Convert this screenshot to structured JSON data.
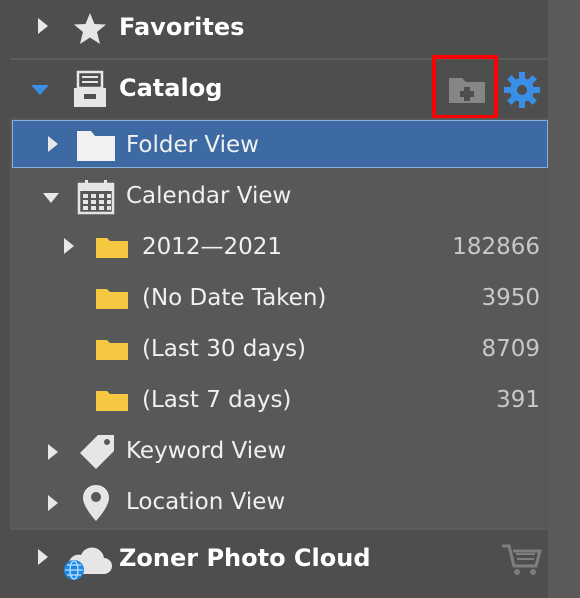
{
  "sections": {
    "favorites": {
      "label": "Favorites"
    },
    "catalog": {
      "label": "Catalog"
    },
    "cloud": {
      "label": "Zoner Photo Cloud"
    }
  },
  "catalog_items": {
    "folder_view": "Folder View",
    "calendar_view": "Calendar View",
    "keyword_view": "Keyword View",
    "location_view": "Location View"
  },
  "calendar_items": [
    {
      "label": "2012—2021",
      "count": "182866"
    },
    {
      "label": "(No Date Taken)",
      "count": "3950"
    },
    {
      "label": "(Last 30 days)",
      "count": "8709"
    },
    {
      "label": "(Last 7 days)",
      "count": "391"
    }
  ],
  "colors": {
    "accent": "#3a8ee6",
    "selection": "#3e6aa3",
    "highlight_box": "#ff0000",
    "folder_yellow": "#f5c842"
  },
  "icons": [
    "star-icon",
    "catalog-icon",
    "add-folder-icon",
    "settings-gear-icon",
    "folder-icon",
    "calendar-icon",
    "tag-icon",
    "location-pin-icon",
    "cloud-globe-icon",
    "cart-icon"
  ]
}
